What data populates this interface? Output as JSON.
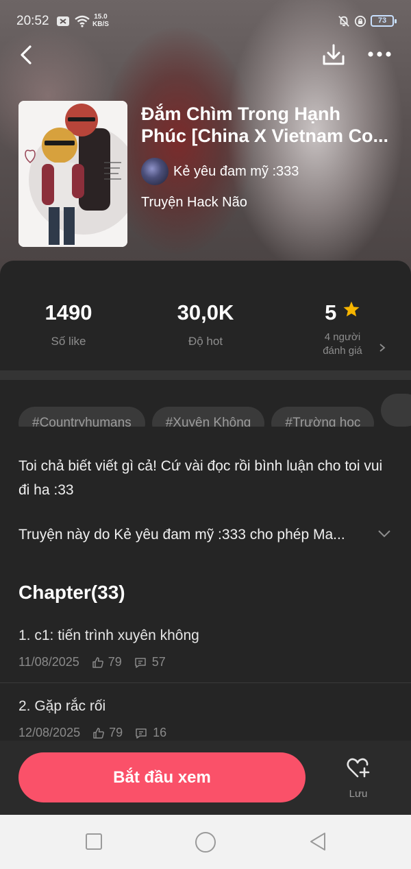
{
  "status_bar": {
    "time": "20:52",
    "speed_value": "15.0",
    "speed_unit": "KB/S",
    "battery": "73"
  },
  "story": {
    "title_line1": "Đắm Chìm Trong Hạnh",
    "title_line2": "Phúc [China X Vietnam Co...",
    "author": "Kẻ yêu đam mỹ :333",
    "category": "Truyện Hack Não"
  },
  "stats": {
    "likes_value": "1490",
    "likes_label": "Số like",
    "hot_value": "30,0K",
    "hot_label": "Độ hot",
    "rating_value": "5",
    "rating_label_line1": "4 người",
    "rating_label_line2": "đánh giá"
  },
  "tags": [
    "#Countryhumans",
    "#Xuyên Không",
    "#Trường học"
  ],
  "description": "Toi chả biết viết gì cả! Cứ vài đọc rồi bình luận cho toi vui đi ha :33",
  "license_text": "Truyện này do Kẻ yêu đam mỹ :333 cho phép Ma...",
  "chapters": {
    "heading": "Chapter(33)",
    "items": [
      {
        "name": "1. c1: tiến trình xuyên không",
        "date": "11/08/2025",
        "likes": "79",
        "comments": "57"
      },
      {
        "name": "2. Gặp rắc rối",
        "date": "12/08/2025",
        "likes": "79",
        "comments": "16"
      }
    ]
  },
  "bottom_bar": {
    "start_label": "Bắt đầu xem",
    "save_label": "Lưu"
  },
  "colors": {
    "accent": "#fa5169",
    "star": "#f7b500",
    "sheet_bg": "#252525"
  }
}
